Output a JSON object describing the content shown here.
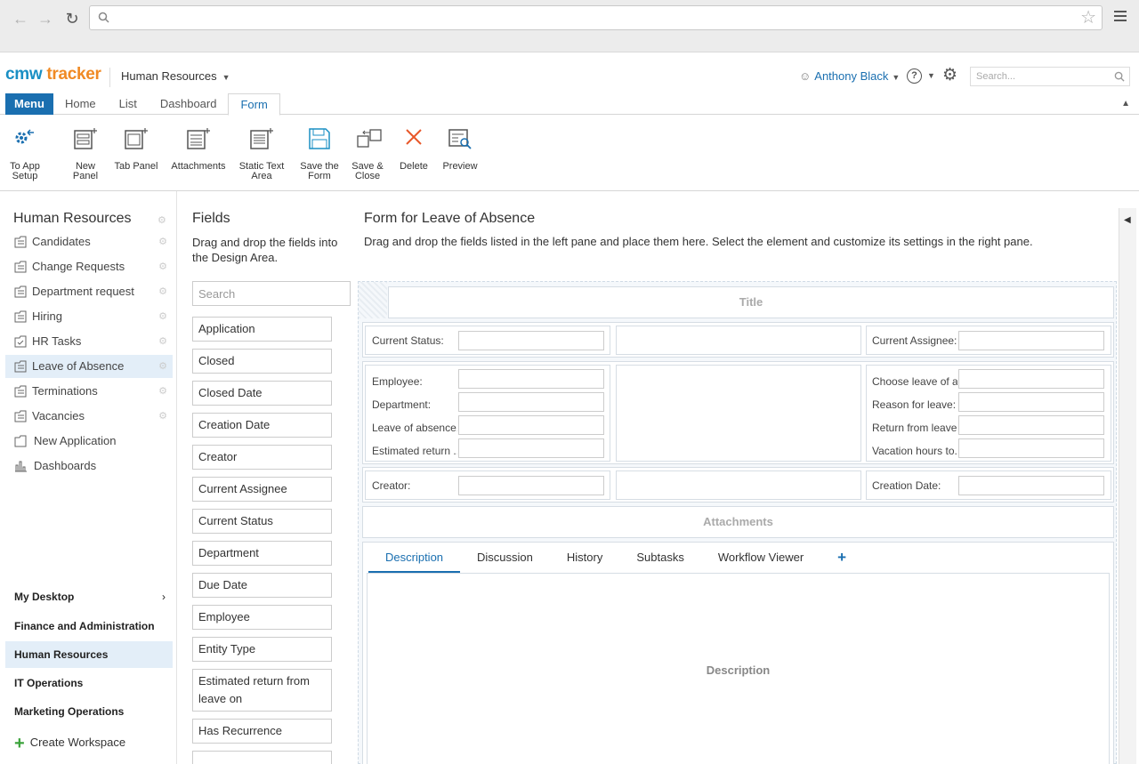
{
  "app": {
    "logo_part1": "cmw",
    "logo_part2": "tracker",
    "workspace": "Human Resources",
    "user": "Anthony Black",
    "search_placeholder": "Search..."
  },
  "tabs": [
    "Menu",
    "Home",
    "List",
    "Dashboard",
    "Form"
  ],
  "toolbar": [
    {
      "l1": "To App",
      "l2": "Setup",
      "icon": "app-setup-icon"
    },
    {
      "l1": "New",
      "l2": "Panel",
      "icon": "new-panel-icon"
    },
    {
      "l1": "Tab Panel",
      "l2": "",
      "icon": "tab-panel-icon"
    },
    {
      "l1": "Attachments",
      "l2": "",
      "icon": "attachments-icon"
    },
    {
      "l1": "Static Text",
      "l2": "Area",
      "icon": "static-text-icon"
    },
    {
      "l1": "Save the",
      "l2": "Form",
      "icon": "save-icon"
    },
    {
      "l1": "Save &",
      "l2": "Close",
      "icon": "save-close-icon"
    },
    {
      "l1": "Delete",
      "l2": "",
      "icon": "delete-icon"
    },
    {
      "l1": "Preview",
      "l2": "",
      "icon": "preview-icon"
    }
  ],
  "leftnav": {
    "title": "Human Resources",
    "items": [
      "Candidates",
      "Change Requests",
      "Department request",
      "Hiring",
      "HR Tasks",
      "Leave of Absence",
      "Terminations",
      "Vacancies",
      "New Application",
      "Dashboards"
    ],
    "workspaces": [
      "My Desktop",
      "Finance and Administration",
      "Human Resources",
      "IT Operations",
      "Marketing Operations"
    ],
    "create_workspace": "Create Workspace"
  },
  "fields": {
    "title": "Fields",
    "description": "Drag and drop the fields into the Design Area.",
    "search_placeholder": "Search",
    "items": [
      "Application",
      "Closed",
      "Closed Date",
      "Creation Date",
      "Creator",
      "Current Assignee",
      "Current Status",
      "Department",
      "Due Date",
      "Employee",
      "Entity Type",
      "Estimated return from leave on",
      "Has Recurrence"
    ]
  },
  "designer": {
    "title": "Form for Leave of Absence",
    "description": "Drag and drop the fields listed in the left pane and place them here. Select the element and customize its settings in the right pane.",
    "title_placeholder": "Title",
    "row1": {
      "left": "Current Status:",
      "right": "Current Assignee:"
    },
    "row2_left": [
      "Employee:",
      "Department:",
      "Leave of absence...",
      "Estimated return ..."
    ],
    "row2_right": [
      "Choose leave of a...",
      "Reason for leave:",
      "Return from leave:",
      "Vacation hours to..."
    ],
    "row3": {
      "left": "Creator:",
      "right": "Creation Date:"
    },
    "attachments": "Attachments",
    "tabs": [
      "Description",
      "Discussion",
      "History",
      "Subtasks",
      "Workflow Viewer"
    ],
    "tab_add": "+",
    "tab_body": "Description"
  }
}
